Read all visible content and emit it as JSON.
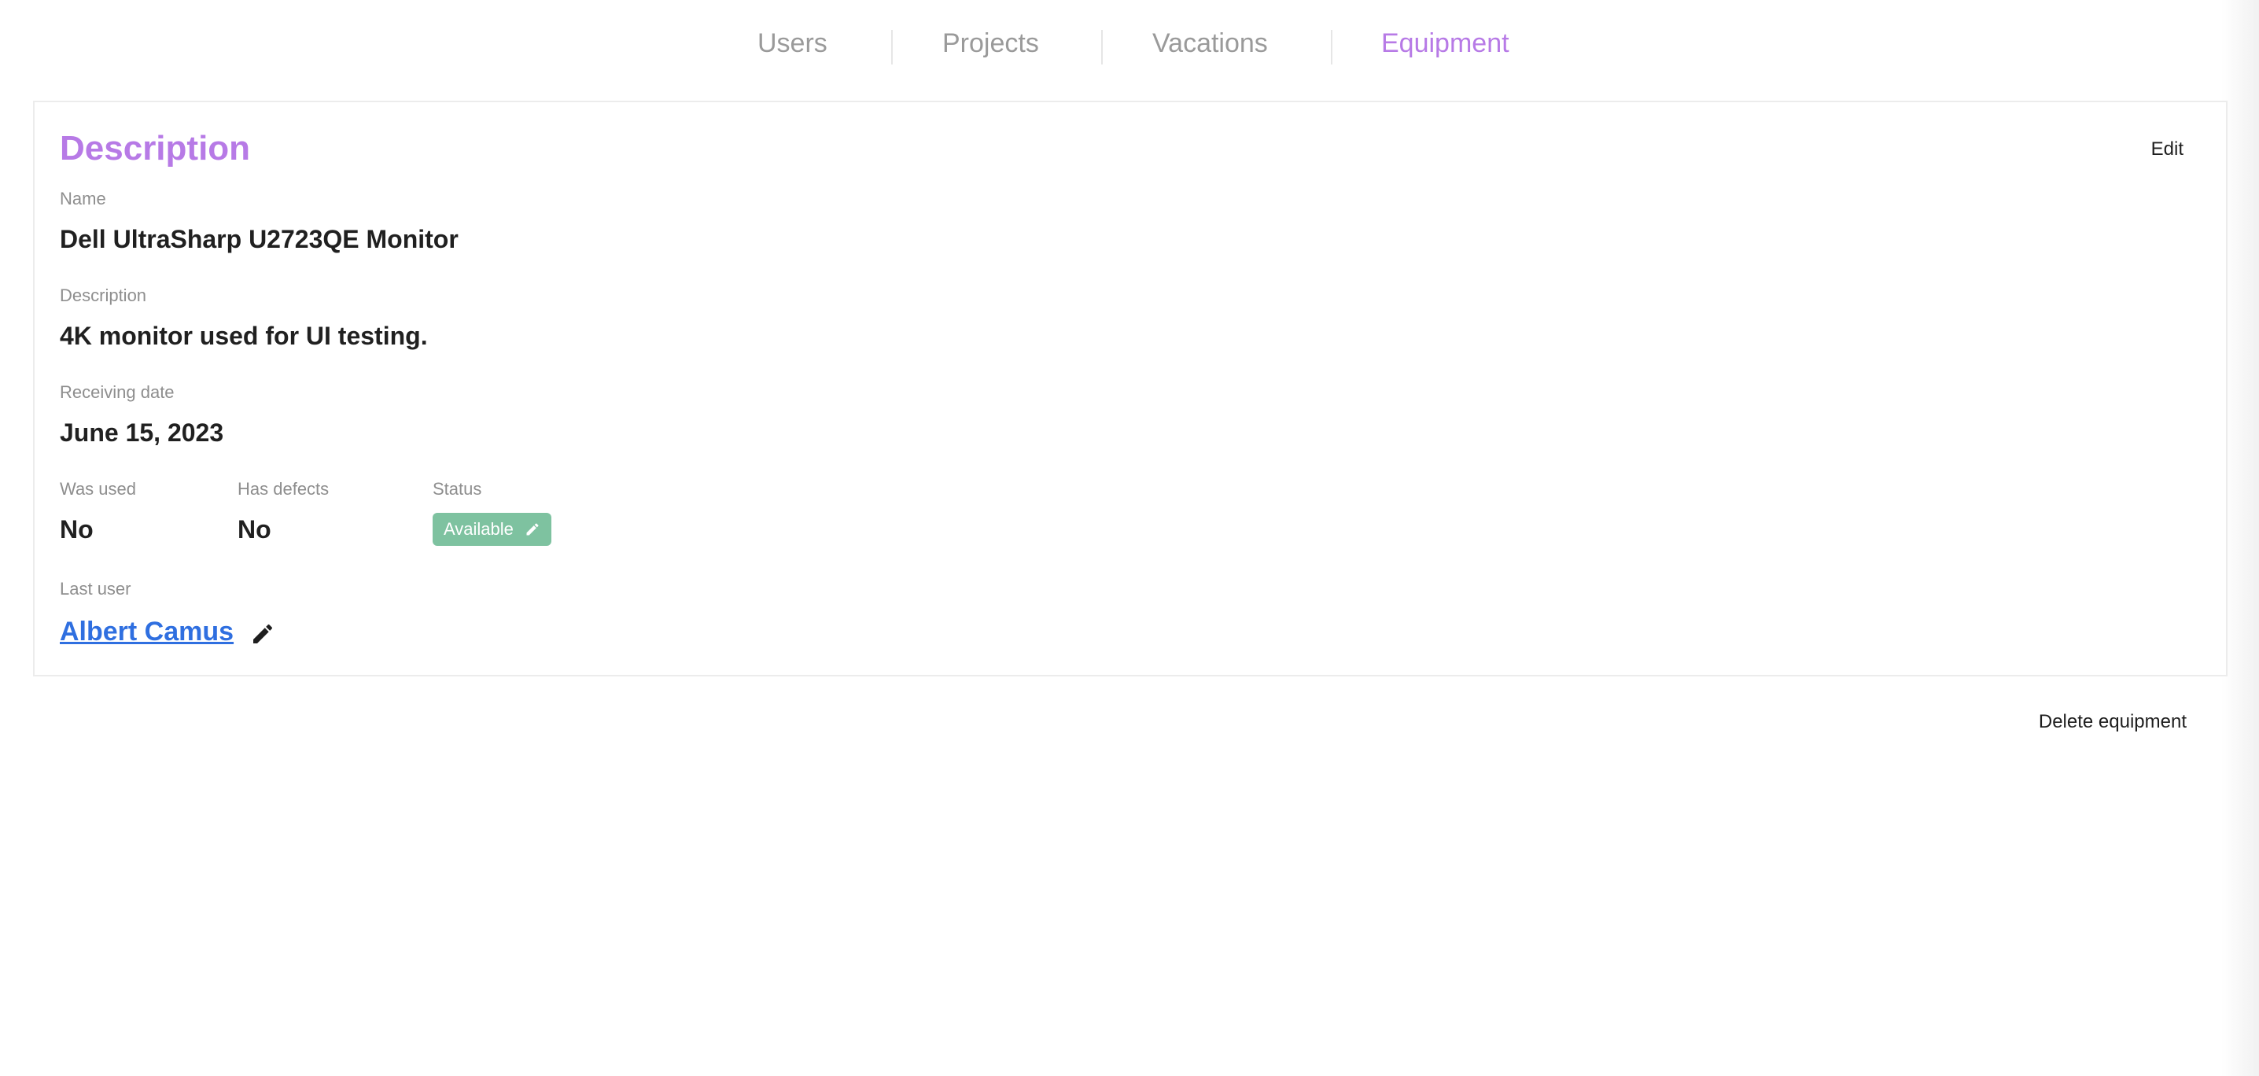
{
  "nav": {
    "tabs": [
      {
        "label": "Users"
      },
      {
        "label": "Projects"
      },
      {
        "label": "Vacations"
      },
      {
        "label": "Equipment"
      }
    ],
    "active": "Equipment"
  },
  "card": {
    "title": "Description",
    "edit_label": "Edit",
    "fields": {
      "name_label": "Name",
      "name_value": "Dell UltraSharp U2723QE Monitor",
      "description_label": "Description",
      "description_value": "4K monitor used for UI testing.",
      "receiving_date_label": "Receiving date",
      "receiving_date_value": "June 15, 2023",
      "was_used_label": "Was used",
      "was_used_value": "No",
      "has_defects_label": "Has defects",
      "has_defects_value": "No",
      "status_label": "Status",
      "status_value": "Available",
      "last_user_label": "Last user",
      "last_user_value": "Albert Camus"
    }
  },
  "footer": {
    "delete_label": "Delete equipment"
  },
  "colors": {
    "accent": "#b77ae6",
    "status_badge": "#7ec2a0",
    "link": "#2f6fe0",
    "muted_text": "#9a9a9a"
  },
  "icons": {
    "status_edit": "pencil-icon",
    "user_edit": "pencil-icon"
  }
}
